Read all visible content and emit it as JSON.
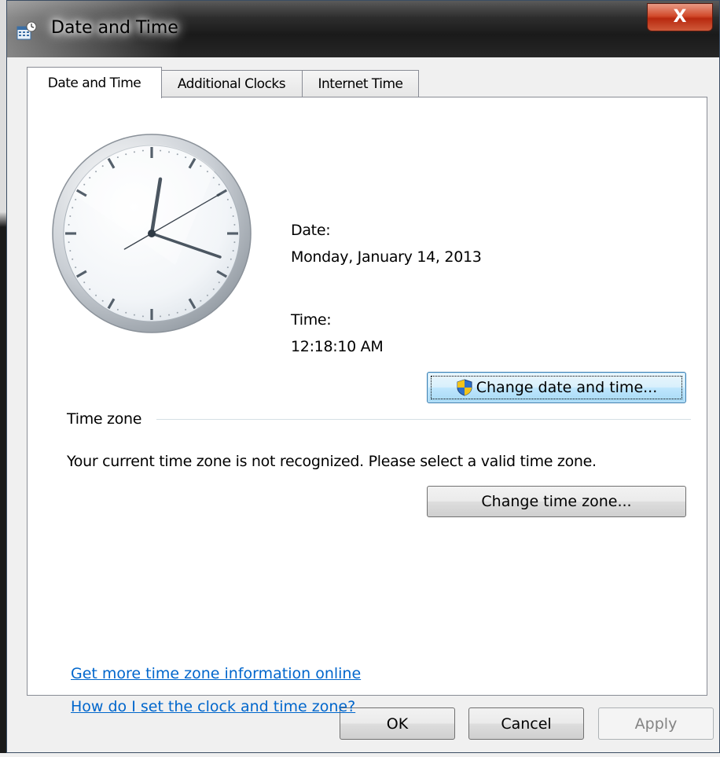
{
  "window": {
    "title": "Date and Time",
    "close_label": "X"
  },
  "tabs": [
    {
      "label": "Date and Time",
      "active": true
    },
    {
      "label": "Additional Clocks",
      "active": false
    },
    {
      "label": "Internet Time",
      "active": false
    }
  ],
  "date_time": {
    "date_label": "Date:",
    "date_value": "Monday, January 14, 2013",
    "time_label": "Time:",
    "time_value": "12:18:10 AM",
    "change_button": "Change date and time..."
  },
  "time_zone": {
    "group_label": "Time zone",
    "message": "Your current time zone is not recognized. Please select a valid time zone.",
    "change_button": "Change time zone..."
  },
  "links": {
    "more_info": "Get more time zone information online",
    "how_to": "How do I set the clock and time zone?"
  },
  "footer": {
    "ok": "OK",
    "cancel": "Cancel",
    "apply": "Apply"
  },
  "clock": {
    "hour": 12,
    "minute": 18,
    "second": 10
  },
  "colors": {
    "link": "#0066cc",
    "close_button": "#c8391b",
    "focus_button": "#bee6fd"
  }
}
